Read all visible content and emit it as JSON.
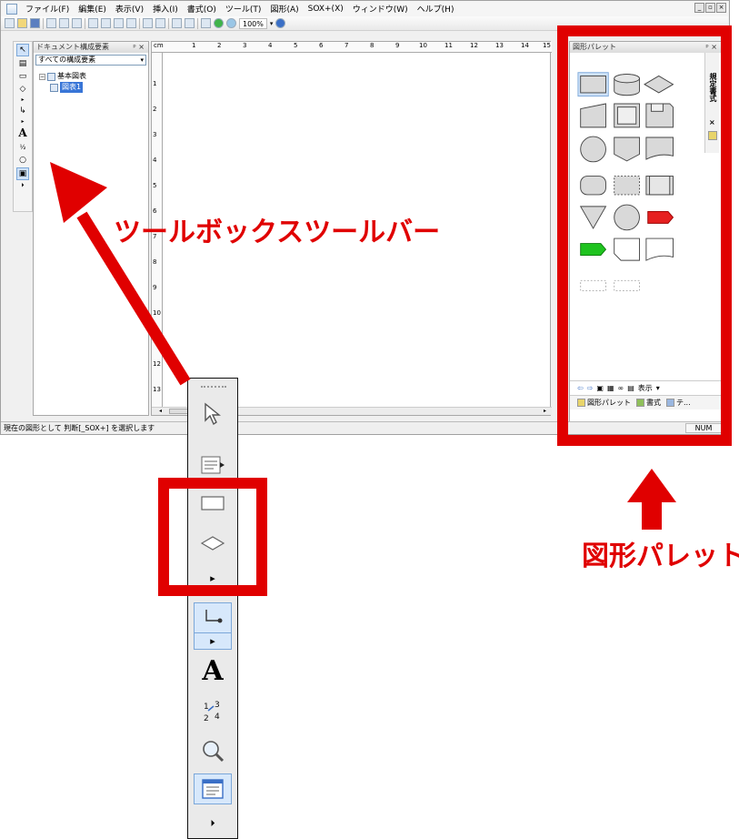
{
  "window": {
    "menu": [
      "ファイル(F)",
      "編集(E)",
      "表示(V)",
      "挿入(I)",
      "書式(O)",
      "ツール(T)",
      "図形(A)",
      "SOX+(X)",
      "ウィンドウ(W)",
      "ヘルプ(H)"
    ],
    "zoom": "100%",
    "winbtns": [
      "_",
      "▫",
      "×"
    ]
  },
  "doc_panel": {
    "title": "ドキュメント構成要素",
    "pin": "ᵖ ×",
    "filter": "すべての構成要素",
    "tree": [
      {
        "label": "基本図表",
        "selected": false
      },
      {
        "label": "図表1",
        "selected": true
      }
    ]
  },
  "ruler": {
    "unit": "cm",
    "top": [
      "1",
      "2",
      "3",
      "4",
      "5",
      "6",
      "7",
      "8",
      "9",
      "10",
      "11",
      "12",
      "13",
      "14",
      "15"
    ],
    "left": [
      "1",
      "2",
      "3",
      "4",
      "5",
      "6",
      "7",
      "8",
      "9",
      "10",
      "11",
      "12",
      "13"
    ]
  },
  "palette": {
    "title": "図形パレット",
    "pin": "ᵖ ×",
    "sidetab": "規定書式",
    "sidetab_close": "×",
    "nav_label": "表示",
    "tabs": [
      "図形パレット",
      "書式",
      "テ..."
    ]
  },
  "statusbar": {
    "text": "現在の図形として 判断[_SOX+] を選択します",
    "num": "NUM"
  },
  "annotations": {
    "toolbar_label": "ツールボックスツールバー",
    "palette_label": "図形パレット"
  },
  "colors": {
    "annotation": "#e00000",
    "shape_fill": "#d9d9d9",
    "selection": "#3875d7",
    "green_tag": "#1fc31f",
    "red_tag": "#e62020"
  }
}
